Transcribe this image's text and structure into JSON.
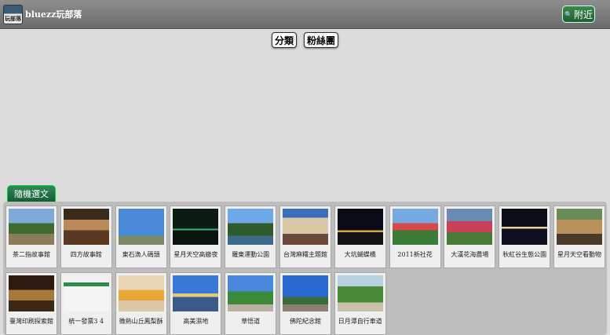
{
  "header": {
    "site_title": "bluezz玩部落",
    "logo_text": "玩部落",
    "nearby_label": "附近",
    "nearby_icon": "search-icon"
  },
  "nav": {
    "category_label": "分類",
    "fans_label": "粉絲團"
  },
  "random_tab": {
    "label": "隨機選文"
  },
  "posts": [
    {
      "title": "茶二指故事館"
    },
    {
      "title": "四方故事館"
    },
    {
      "title": "東石漁人碼頭"
    },
    {
      "title": "星月天空高繳夜"
    },
    {
      "title": "羅東運動公園"
    },
    {
      "title": "台灣麻糬主題館"
    },
    {
      "title": "大坑蝴蝶橋"
    },
    {
      "title": "2011新社花"
    },
    {
      "title": "大漢花海農場"
    },
    {
      "title": "秋紅谷生態公園"
    },
    {
      "title": "星月天空看動物"
    },
    {
      "title": "臺灣印刷探索館"
    },
    {
      "title": "統一發票3 4"
    },
    {
      "title": "微熱山丘鳳梨酥"
    },
    {
      "title": "高美濕地"
    },
    {
      "title": "草悟道"
    },
    {
      "title": "佛陀紀念館"
    },
    {
      "title": "日月潭自行車道"
    }
  ]
}
